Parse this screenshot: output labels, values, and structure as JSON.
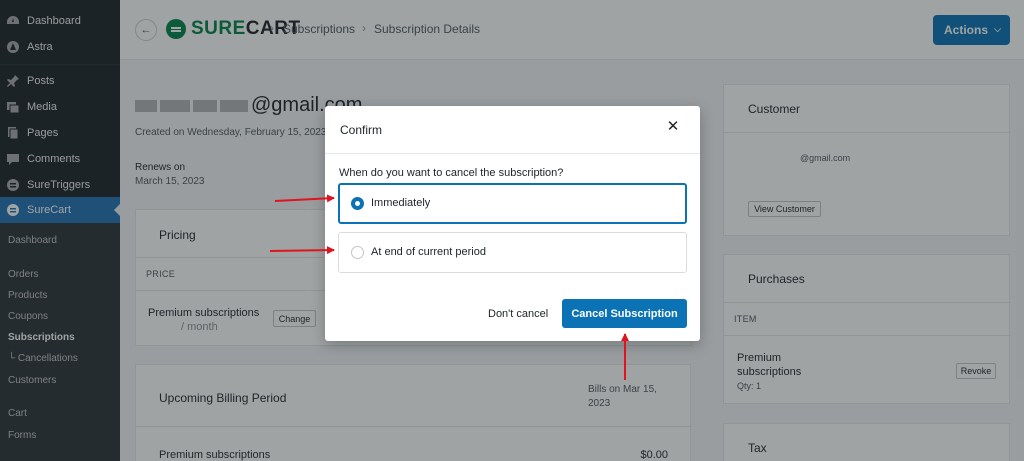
{
  "sidebar": {
    "items": [
      {
        "label": "Dashboard",
        "icon": "dashboard-icon"
      },
      {
        "label": "Astra",
        "icon": "astra-icon"
      },
      {
        "label": "Posts",
        "icon": "pin-icon"
      },
      {
        "label": "Media",
        "icon": "media-icon"
      },
      {
        "label": "Pages",
        "icon": "pages-icon"
      },
      {
        "label": "Comments",
        "icon": "comments-icon"
      },
      {
        "label": "SureTriggers",
        "icon": "suretriggers-icon"
      },
      {
        "label": "SureCart",
        "icon": "surecart-icon"
      }
    ],
    "submenu": [
      "Dashboard",
      "Orders",
      "Products",
      "Coupons",
      "Subscriptions",
      "└ Cancellations",
      "Customers",
      "Cart",
      "Forms"
    ]
  },
  "header": {
    "logo_left": "SURE",
    "logo_right": "CART",
    "breadcrumb_1": "Subscriptions",
    "breadcrumb_2": "Subscription Details",
    "separator": "›",
    "actions_label": "Actions"
  },
  "main": {
    "email_domain": "@gmail.com",
    "created": "Created on Wednesday, February 15, 2023",
    "renews_label": "Renews on",
    "renews_date": "March 15, 2023",
    "pricing_title": "Pricing",
    "price_col": "PRICE",
    "plan_name": "Premium subscriptions",
    "plan_period": "/ month",
    "change_label": "Change",
    "upcoming_title": "Upcoming Billing Period",
    "bills_on": "Bills on Mar 15, 2023",
    "upcoming_item": "Premium subscriptions",
    "upcoming_amount": "$0.00"
  },
  "right": {
    "customer_title": "Customer",
    "customer_email": "@gmail.com",
    "view_customer": "View Customer",
    "purchases_title": "Purchases",
    "item_col": "ITEM",
    "purchase_name_1": "Premium",
    "purchase_name_2": "subscriptions",
    "purchase_qty": "Qty: 1",
    "revoke": "Revoke",
    "tax_title": "Tax"
  },
  "modal": {
    "title": "Confirm",
    "close_glyph": "✕",
    "question": "When do you want to cancel the subscription?",
    "option_immediately": "Immediately",
    "option_end": "At end of current period",
    "selected": "Immediately",
    "dont_cancel": "Don't cancel",
    "cancel_button": "Cancel Subscription"
  },
  "colors": {
    "accent": "#0a72b5",
    "brand_green": "#01824c",
    "annotation": "#e0141e"
  }
}
